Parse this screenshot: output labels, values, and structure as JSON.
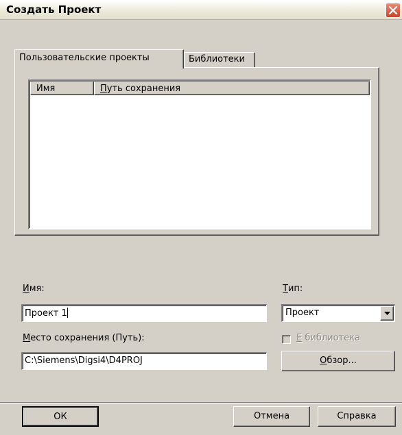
{
  "window": {
    "title": "Создать Проект",
    "close_icon": "close-icon"
  },
  "tabs": [
    {
      "label": "Пользовательские проекты",
      "active": true
    },
    {
      "label": "Библиотеки",
      "active": false
    }
  ],
  "list": {
    "columns": [
      {
        "label": "Имя"
      },
      {
        "label_first": "П",
        "label_rest": "уть сохранения"
      }
    ],
    "rows": []
  },
  "form": {
    "name_label_ul": "И",
    "name_label_rest": "мя:",
    "name_value": "Проект 1",
    "type_label_ul": "Т",
    "type_label_rest": "ип:",
    "type_value": "Проект",
    "path_label_ul": "М",
    "path_label_rest": "есто сохранения (Путь):",
    "path_value": "C:\\Siemens\\Digsi4\\D4PROJ",
    "library_checkbox_ul": "Е",
    "library_checkbox_rest": " библиотека",
    "library_checked": false,
    "browse_ul": "О",
    "browse_rest": "бзор..."
  },
  "buttons": {
    "ok": "ОК",
    "cancel": "Отмена",
    "help": "Справка"
  },
  "colors": {
    "dialog_bg": "#d4d0c8",
    "close_button": "#c8452a"
  }
}
